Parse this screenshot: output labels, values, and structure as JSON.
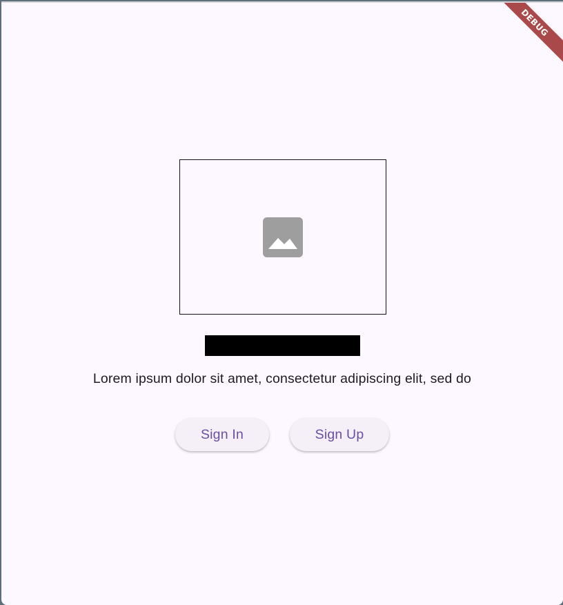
{
  "app": {
    "debug_banner": "DEBUG"
  },
  "hero": {
    "image_icon": "image-icon",
    "title": "",
    "description": "Lorem ipsum dolor sit amet, consectetur adipiscing elit, sed do"
  },
  "actions": {
    "sign_in_label": "Sign In",
    "sign_up_label": "Sign Up"
  },
  "colors": {
    "background": "#fdf7ff",
    "accent": "#6750a4",
    "button_surface": "#f5eff7",
    "debug_ribbon": "#a33b3b",
    "title_redaction": "#000000"
  }
}
